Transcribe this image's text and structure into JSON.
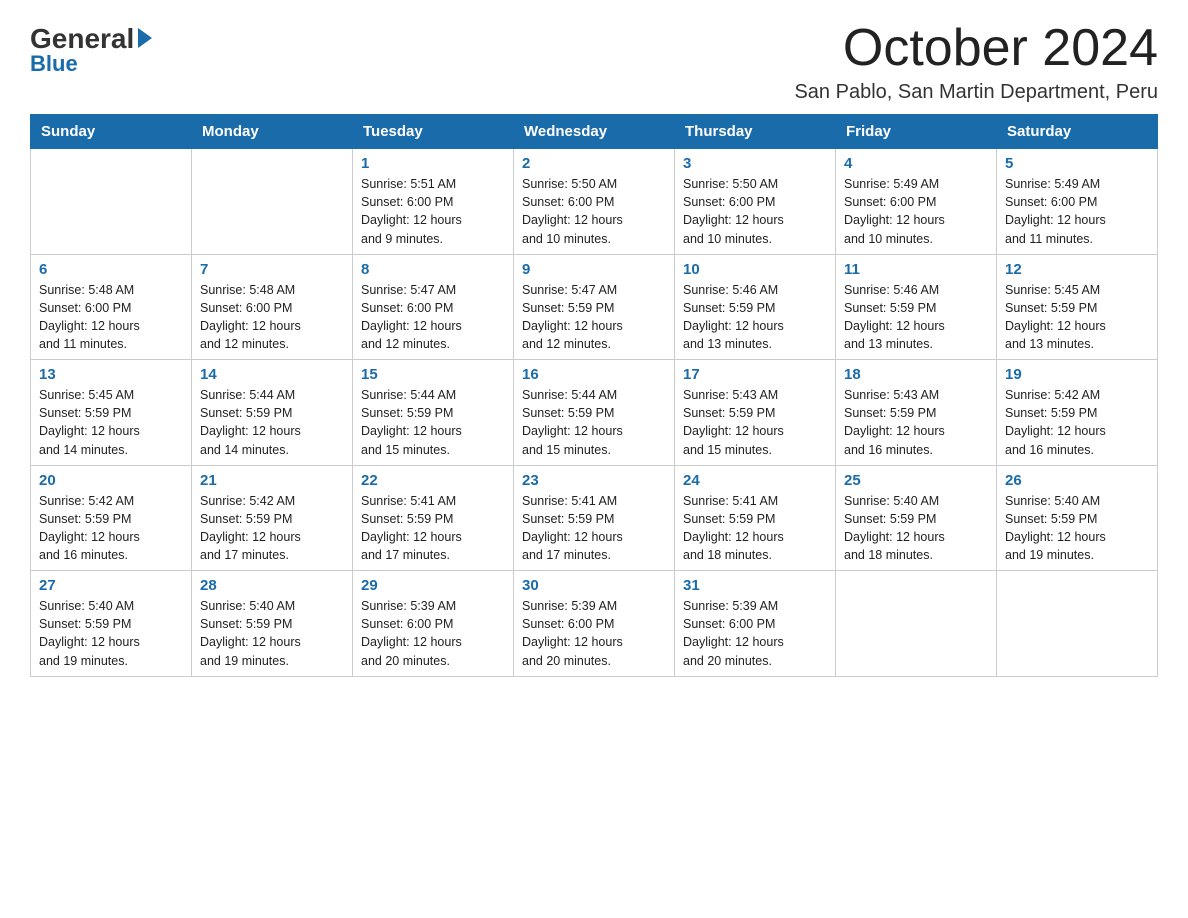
{
  "logo": {
    "general": "General",
    "blue": "Blue"
  },
  "title": "October 2024",
  "location": "San Pablo, San Martin Department, Peru",
  "headers": [
    "Sunday",
    "Monday",
    "Tuesday",
    "Wednesday",
    "Thursday",
    "Friday",
    "Saturday"
  ],
  "weeks": [
    [
      {
        "day": "",
        "info": ""
      },
      {
        "day": "",
        "info": ""
      },
      {
        "day": "1",
        "info": "Sunrise: 5:51 AM\nSunset: 6:00 PM\nDaylight: 12 hours\nand 9 minutes."
      },
      {
        "day": "2",
        "info": "Sunrise: 5:50 AM\nSunset: 6:00 PM\nDaylight: 12 hours\nand 10 minutes."
      },
      {
        "day": "3",
        "info": "Sunrise: 5:50 AM\nSunset: 6:00 PM\nDaylight: 12 hours\nand 10 minutes."
      },
      {
        "day": "4",
        "info": "Sunrise: 5:49 AM\nSunset: 6:00 PM\nDaylight: 12 hours\nand 10 minutes."
      },
      {
        "day": "5",
        "info": "Sunrise: 5:49 AM\nSunset: 6:00 PM\nDaylight: 12 hours\nand 11 minutes."
      }
    ],
    [
      {
        "day": "6",
        "info": "Sunrise: 5:48 AM\nSunset: 6:00 PM\nDaylight: 12 hours\nand 11 minutes."
      },
      {
        "day": "7",
        "info": "Sunrise: 5:48 AM\nSunset: 6:00 PM\nDaylight: 12 hours\nand 12 minutes."
      },
      {
        "day": "8",
        "info": "Sunrise: 5:47 AM\nSunset: 6:00 PM\nDaylight: 12 hours\nand 12 minutes."
      },
      {
        "day": "9",
        "info": "Sunrise: 5:47 AM\nSunset: 5:59 PM\nDaylight: 12 hours\nand 12 minutes."
      },
      {
        "day": "10",
        "info": "Sunrise: 5:46 AM\nSunset: 5:59 PM\nDaylight: 12 hours\nand 13 minutes."
      },
      {
        "day": "11",
        "info": "Sunrise: 5:46 AM\nSunset: 5:59 PM\nDaylight: 12 hours\nand 13 minutes."
      },
      {
        "day": "12",
        "info": "Sunrise: 5:45 AM\nSunset: 5:59 PM\nDaylight: 12 hours\nand 13 minutes."
      }
    ],
    [
      {
        "day": "13",
        "info": "Sunrise: 5:45 AM\nSunset: 5:59 PM\nDaylight: 12 hours\nand 14 minutes."
      },
      {
        "day": "14",
        "info": "Sunrise: 5:44 AM\nSunset: 5:59 PM\nDaylight: 12 hours\nand 14 minutes."
      },
      {
        "day": "15",
        "info": "Sunrise: 5:44 AM\nSunset: 5:59 PM\nDaylight: 12 hours\nand 15 minutes."
      },
      {
        "day": "16",
        "info": "Sunrise: 5:44 AM\nSunset: 5:59 PM\nDaylight: 12 hours\nand 15 minutes."
      },
      {
        "day": "17",
        "info": "Sunrise: 5:43 AM\nSunset: 5:59 PM\nDaylight: 12 hours\nand 15 minutes."
      },
      {
        "day": "18",
        "info": "Sunrise: 5:43 AM\nSunset: 5:59 PM\nDaylight: 12 hours\nand 16 minutes."
      },
      {
        "day": "19",
        "info": "Sunrise: 5:42 AM\nSunset: 5:59 PM\nDaylight: 12 hours\nand 16 minutes."
      }
    ],
    [
      {
        "day": "20",
        "info": "Sunrise: 5:42 AM\nSunset: 5:59 PM\nDaylight: 12 hours\nand 16 minutes."
      },
      {
        "day": "21",
        "info": "Sunrise: 5:42 AM\nSunset: 5:59 PM\nDaylight: 12 hours\nand 17 minutes."
      },
      {
        "day": "22",
        "info": "Sunrise: 5:41 AM\nSunset: 5:59 PM\nDaylight: 12 hours\nand 17 minutes."
      },
      {
        "day": "23",
        "info": "Sunrise: 5:41 AM\nSunset: 5:59 PM\nDaylight: 12 hours\nand 17 minutes."
      },
      {
        "day": "24",
        "info": "Sunrise: 5:41 AM\nSunset: 5:59 PM\nDaylight: 12 hours\nand 18 minutes."
      },
      {
        "day": "25",
        "info": "Sunrise: 5:40 AM\nSunset: 5:59 PM\nDaylight: 12 hours\nand 18 minutes."
      },
      {
        "day": "26",
        "info": "Sunrise: 5:40 AM\nSunset: 5:59 PM\nDaylight: 12 hours\nand 19 minutes."
      }
    ],
    [
      {
        "day": "27",
        "info": "Sunrise: 5:40 AM\nSunset: 5:59 PM\nDaylight: 12 hours\nand 19 minutes."
      },
      {
        "day": "28",
        "info": "Sunrise: 5:40 AM\nSunset: 5:59 PM\nDaylight: 12 hours\nand 19 minutes."
      },
      {
        "day": "29",
        "info": "Sunrise: 5:39 AM\nSunset: 6:00 PM\nDaylight: 12 hours\nand 20 minutes."
      },
      {
        "day": "30",
        "info": "Sunrise: 5:39 AM\nSunset: 6:00 PM\nDaylight: 12 hours\nand 20 minutes."
      },
      {
        "day": "31",
        "info": "Sunrise: 5:39 AM\nSunset: 6:00 PM\nDaylight: 12 hours\nand 20 minutes."
      },
      {
        "day": "",
        "info": ""
      },
      {
        "day": "",
        "info": ""
      }
    ]
  ]
}
